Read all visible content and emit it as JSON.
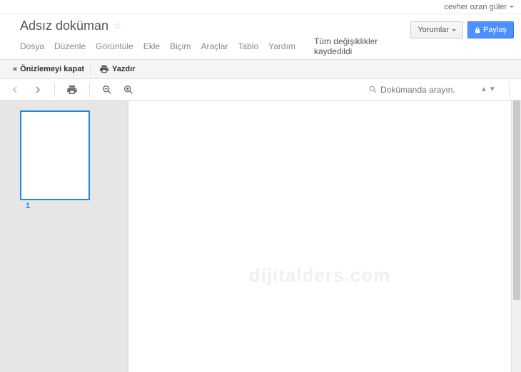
{
  "user": {
    "name": "cevher ozan güler"
  },
  "header": {
    "title": "Adsız doküman",
    "menus": [
      "Dosya",
      "Düzenle",
      "Görüntüle",
      "Ekle",
      "Biçim",
      "Araçlar",
      "Tablo",
      "Yardım"
    ],
    "save_status": "Tüm değişiklikler kaydedildi",
    "comments_label": "Yorumlar",
    "share_label": "Paylaş"
  },
  "secondary": {
    "close_preview": "Önizlemeyi kapat",
    "print": "Yazdır"
  },
  "search": {
    "placeholder": "Dokümanda arayın."
  },
  "thumbs": {
    "page1": "1"
  },
  "watermark": "dijitalders.com"
}
